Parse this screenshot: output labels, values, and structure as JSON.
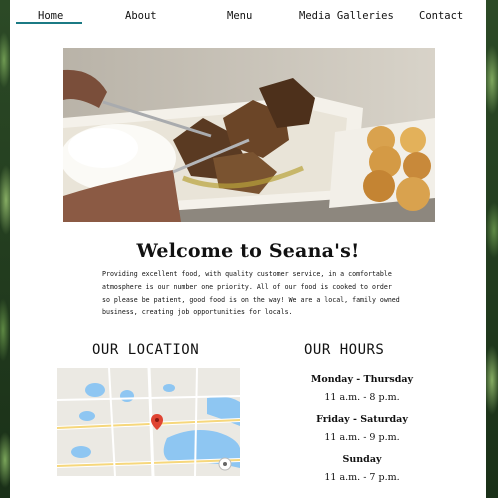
{
  "nav": {
    "items": [
      {
        "label": "Home",
        "active": true
      },
      {
        "label": "About"
      },
      {
        "label": "Menu"
      },
      {
        "label": "Media Galleries"
      },
      {
        "label": "Contact"
      }
    ]
  },
  "hero": {
    "alt": "plate of rice and grilled chicken with muffins"
  },
  "main": {
    "title": "Welcome to Seana's!",
    "intro": "Providing excellent food, with quality customer service, in a comfortable atmosphere is our number one priority. All of our food is cooked to order so please be patient, good food is on the way! We are a local, family owned business, creating job opportunities for locals."
  },
  "location": {
    "heading": "OUR LOCATION"
  },
  "hours": {
    "heading": "OUR HOURS",
    "rows": [
      {
        "day": "Monday - Thursday",
        "time": "11 a.m. - 8 p.m."
      },
      {
        "day": "Friday - Saturday",
        "time": "11 a.m. - 9 p.m."
      },
      {
        "day": "Sunday",
        "time": "11 a.m. - 7 p.m."
      }
    ]
  },
  "colors": {
    "accent": "#1b7a84",
    "map_water": "#8ec6f2",
    "pin": "#e04433"
  }
}
